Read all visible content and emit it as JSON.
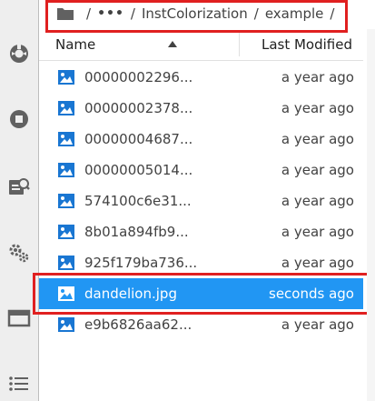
{
  "breadcrumb": {
    "separator": "/",
    "ellipsis": "•••",
    "path": [
      "InstColorization",
      "example"
    ]
  },
  "header": {
    "name_label": "Name",
    "modified_label": "Last Modified",
    "sort_direction": "ascending"
  },
  "files": [
    {
      "name": "00000002296...",
      "modified": "a year ago",
      "icon": "image-icon",
      "selected": false
    },
    {
      "name": "00000002378...",
      "modified": "a year ago",
      "icon": "image-icon",
      "selected": false
    },
    {
      "name": "00000004687...",
      "modified": "a year ago",
      "icon": "image-icon",
      "selected": false
    },
    {
      "name": "00000005014...",
      "modified": "a year ago",
      "icon": "image-icon",
      "selected": false
    },
    {
      "name": "574100c6e31...",
      "modified": "a year ago",
      "icon": "image-icon",
      "selected": false
    },
    {
      "name": "8b01a894fb9...",
      "modified": "a year ago",
      "icon": "image-icon",
      "selected": false
    },
    {
      "name": "925f179ba736...",
      "modified": "a year ago",
      "icon": "image-icon",
      "selected": false
    },
    {
      "name": "dandelion.jpg",
      "modified": "seconds ago",
      "icon": "image-icon",
      "selected": true
    },
    {
      "name": "e9b6826aa62...",
      "modified": "a year ago",
      "icon": "image-icon",
      "selected": false
    }
  ],
  "activity_bar": [
    "palette-icon",
    "stop-icon",
    "property-inspector-icon",
    "extension-manager-icon",
    "tabs-icon",
    "table-of-contents-icon"
  ],
  "colors": {
    "accent": "#2196f3",
    "icon_blue": "#1976d2",
    "highlight_border": "#e02020",
    "sidebar_bg": "#eeeeee"
  }
}
